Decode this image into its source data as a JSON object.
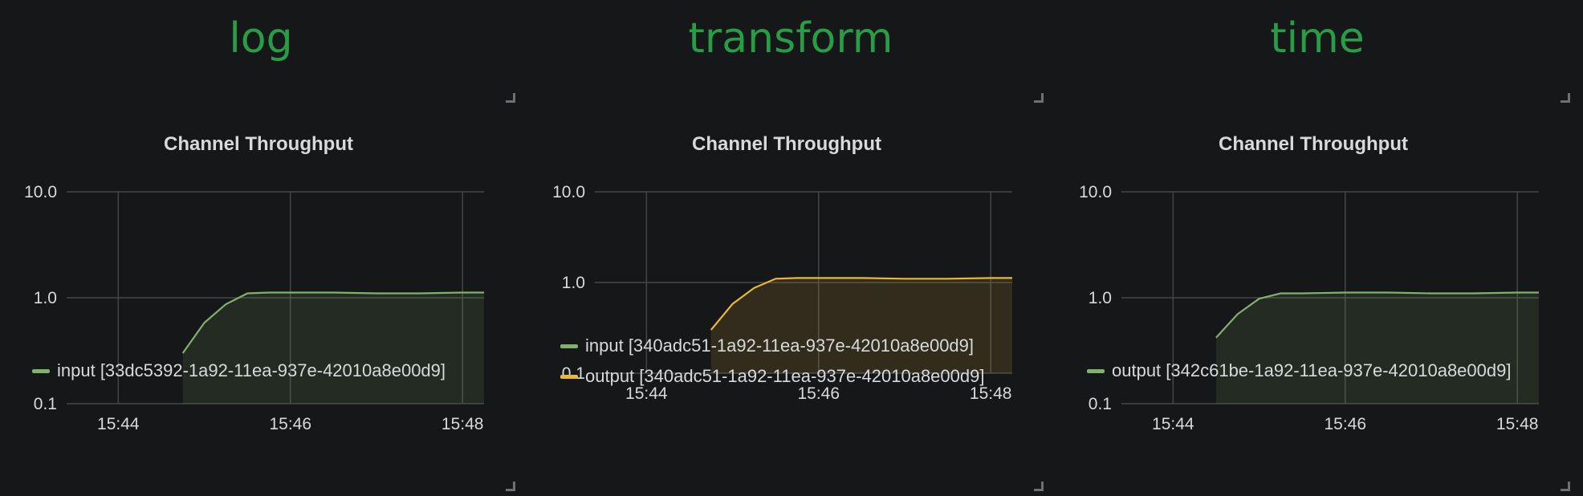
{
  "panels": [
    {
      "header": "log",
      "title": "Channel Throughput"
    },
    {
      "header": "transform",
      "title": "Channel Throughput"
    },
    {
      "header": "time",
      "title": "Channel Throughput"
    }
  ],
  "chart_data": [
    {
      "type": "area",
      "title": "Channel Throughput",
      "yscale": "log",
      "ylim": [
        0.1,
        10
      ],
      "yticks": [
        "10.0",
        "1.0",
        "0.1"
      ],
      "xlim": [
        "15:43:24",
        "15:48:15"
      ],
      "xticks": [
        "15:44",
        "15:46",
        "15:48"
      ],
      "legend_position": "bottom",
      "grid": true,
      "series": [
        {
          "name": "input [33dc5392-1a92-11ea-937e-42010a8e00d9]",
          "color": "#7eb26d",
          "x": [
            "15:44:45",
            "15:45:00",
            "15:45:15",
            "15:45:30",
            "15:45:45",
            "15:46:00",
            "15:46:30",
            "15:47:00",
            "15:47:30",
            "15:48:00",
            "15:48:15"
          ],
          "y": [
            0.3,
            0.58,
            0.87,
            1.1,
            1.12,
            1.12,
            1.12,
            1.1,
            1.1,
            1.12,
            1.12
          ]
        }
      ]
    },
    {
      "type": "area",
      "title": "Channel Throughput",
      "yscale": "log",
      "ylim": [
        0.1,
        10
      ],
      "yticks": [
        "10.0",
        "1.0",
        "0.1"
      ],
      "xlim": [
        "15:43:24",
        "15:48:15"
      ],
      "xticks": [
        "15:44",
        "15:46",
        "15:48"
      ],
      "legend_position": "bottom",
      "grid": true,
      "series": [
        {
          "name": "input [340adc51-1a92-11ea-937e-42010a8e00d9]",
          "color": "#7eb26d",
          "x": [],
          "y": []
        },
        {
          "name": "output [340adc51-1a92-11ea-937e-42010a8e00d9]",
          "color": "#eab839",
          "x": [
            "15:44:45",
            "15:45:00",
            "15:45:15",
            "15:45:30",
            "15:45:45",
            "15:46:00",
            "15:46:30",
            "15:47:00",
            "15:47:30",
            "15:48:00",
            "15:48:15"
          ],
          "y": [
            0.3,
            0.58,
            0.87,
            1.1,
            1.12,
            1.12,
            1.12,
            1.1,
            1.1,
            1.12,
            1.12
          ]
        }
      ]
    },
    {
      "type": "area",
      "title": "Channel Throughput",
      "yscale": "log",
      "ylim": [
        0.1,
        10
      ],
      "yticks": [
        "10.0",
        "1.0",
        "0.1"
      ],
      "xlim": [
        "15:43:24",
        "15:48:15"
      ],
      "xticks": [
        "15:44",
        "15:46",
        "15:48"
      ],
      "legend_position": "bottom",
      "grid": true,
      "series": [
        {
          "name": "output [342c61be-1a92-11ea-937e-42010a8e00d9]",
          "color": "#7eb26d",
          "x": [
            "15:44:30",
            "15:44:45",
            "15:45:00",
            "15:45:15",
            "15:45:30",
            "15:46:00",
            "15:46:30",
            "15:47:00",
            "15:47:30",
            "15:48:00",
            "15:48:15"
          ],
          "y": [
            0.42,
            0.7,
            0.98,
            1.1,
            1.1,
            1.12,
            1.12,
            1.1,
            1.1,
            1.12,
            1.12
          ]
        }
      ]
    }
  ]
}
